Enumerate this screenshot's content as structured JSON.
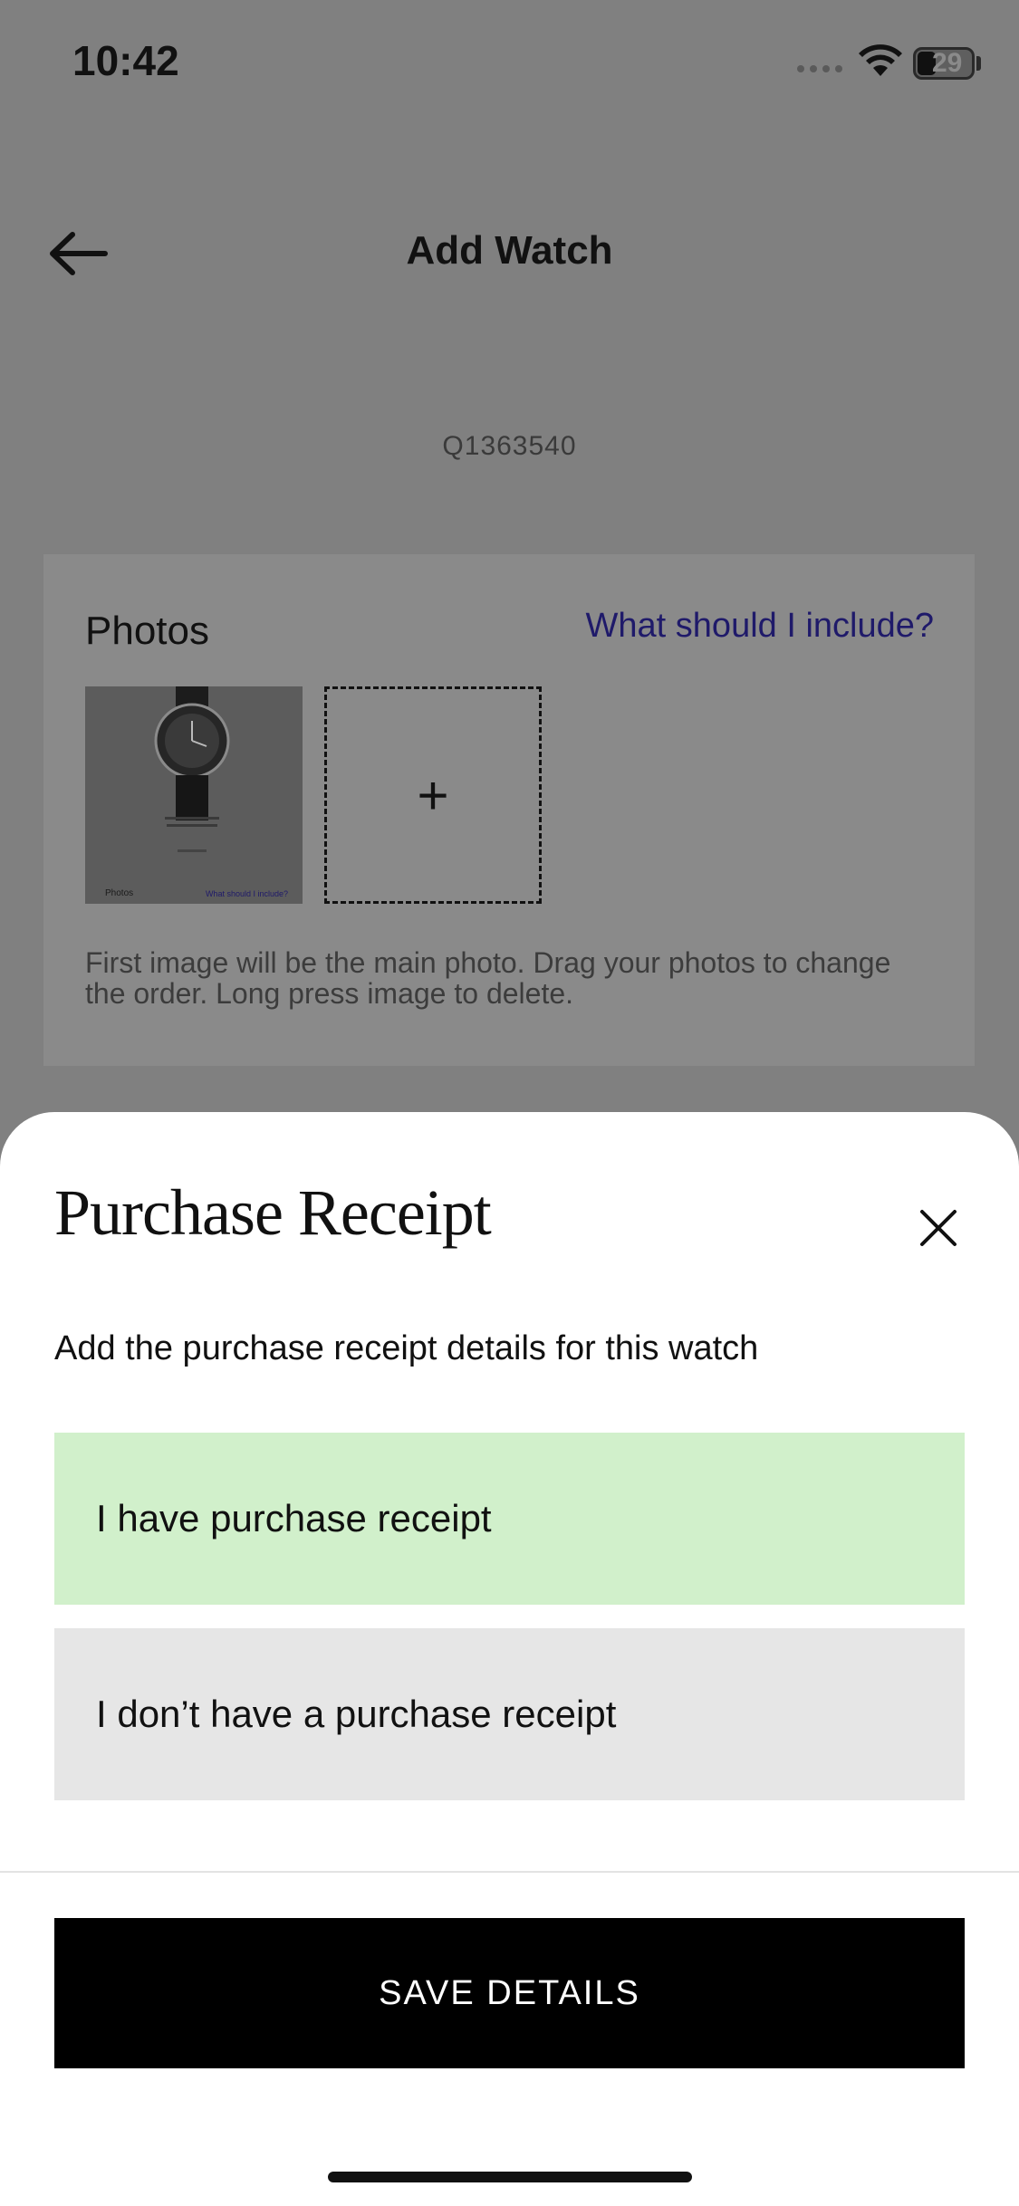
{
  "status_bar": {
    "time": "10:42",
    "battery": "29"
  },
  "nav": {
    "title": "Add Watch",
    "back_icon": "arrow-left-icon"
  },
  "reference_code": "Q1363540",
  "photos": {
    "title": "Photos",
    "help_link": "What should I include?",
    "thumbnail_caption": "Photos",
    "thumbnail_link": "What should I include?",
    "add_icon": "+",
    "hint": "First image will be the main photo. Drag your photos to change the order. Long press image to delete."
  },
  "sheet": {
    "title": "Purchase Receipt",
    "close_icon": "close-icon",
    "description": "Add the purchase receipt details for this watch",
    "options": [
      {
        "label": "I have purchase receipt",
        "selected": true,
        "color": "#d1f0cb"
      },
      {
        "label": "I don’t have a purchase receipt",
        "selected": false,
        "color": "#e6e6e6"
      }
    ],
    "save_label": "SAVE DETAILS"
  }
}
